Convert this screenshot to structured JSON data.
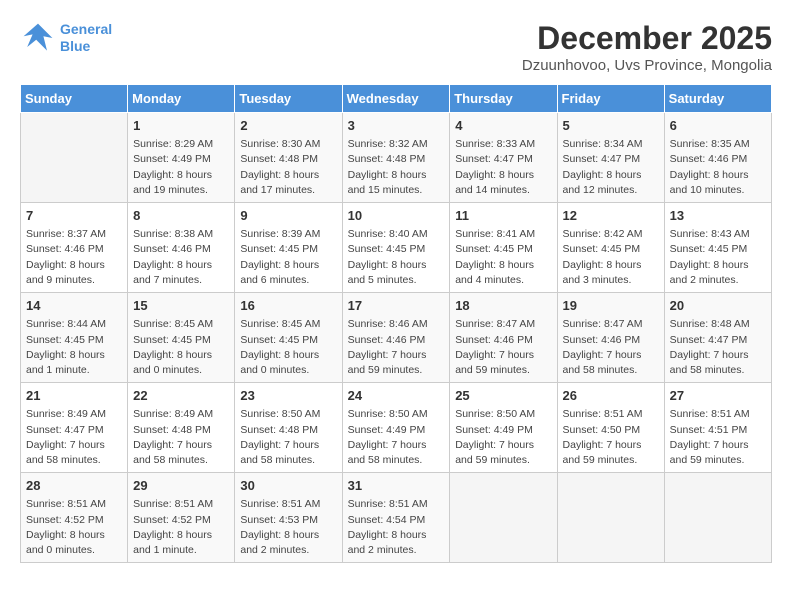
{
  "header": {
    "logo_line1": "General",
    "logo_line2": "Blue",
    "month": "December 2025",
    "location": "Dzuunhovoo, Uvs Province, Mongolia"
  },
  "weekdays": [
    "Sunday",
    "Monday",
    "Tuesday",
    "Wednesday",
    "Thursday",
    "Friday",
    "Saturday"
  ],
  "weeks": [
    [
      {
        "day": "",
        "content": ""
      },
      {
        "day": "1",
        "content": "Sunrise: 8:29 AM\nSunset: 4:49 PM\nDaylight: 8 hours\nand 19 minutes."
      },
      {
        "day": "2",
        "content": "Sunrise: 8:30 AM\nSunset: 4:48 PM\nDaylight: 8 hours\nand 17 minutes."
      },
      {
        "day": "3",
        "content": "Sunrise: 8:32 AM\nSunset: 4:48 PM\nDaylight: 8 hours\nand 15 minutes."
      },
      {
        "day": "4",
        "content": "Sunrise: 8:33 AM\nSunset: 4:47 PM\nDaylight: 8 hours\nand 14 minutes."
      },
      {
        "day": "5",
        "content": "Sunrise: 8:34 AM\nSunset: 4:47 PM\nDaylight: 8 hours\nand 12 minutes."
      },
      {
        "day": "6",
        "content": "Sunrise: 8:35 AM\nSunset: 4:46 PM\nDaylight: 8 hours\nand 10 minutes."
      }
    ],
    [
      {
        "day": "7",
        "content": "Sunrise: 8:37 AM\nSunset: 4:46 PM\nDaylight: 8 hours\nand 9 minutes."
      },
      {
        "day": "8",
        "content": "Sunrise: 8:38 AM\nSunset: 4:46 PM\nDaylight: 8 hours\nand 7 minutes."
      },
      {
        "day": "9",
        "content": "Sunrise: 8:39 AM\nSunset: 4:45 PM\nDaylight: 8 hours\nand 6 minutes."
      },
      {
        "day": "10",
        "content": "Sunrise: 8:40 AM\nSunset: 4:45 PM\nDaylight: 8 hours\nand 5 minutes."
      },
      {
        "day": "11",
        "content": "Sunrise: 8:41 AM\nSunset: 4:45 PM\nDaylight: 8 hours\nand 4 minutes."
      },
      {
        "day": "12",
        "content": "Sunrise: 8:42 AM\nSunset: 4:45 PM\nDaylight: 8 hours\nand 3 minutes."
      },
      {
        "day": "13",
        "content": "Sunrise: 8:43 AM\nSunset: 4:45 PM\nDaylight: 8 hours\nand 2 minutes."
      }
    ],
    [
      {
        "day": "14",
        "content": "Sunrise: 8:44 AM\nSunset: 4:45 PM\nDaylight: 8 hours\nand 1 minute."
      },
      {
        "day": "15",
        "content": "Sunrise: 8:45 AM\nSunset: 4:45 PM\nDaylight: 8 hours\nand 0 minutes."
      },
      {
        "day": "16",
        "content": "Sunrise: 8:45 AM\nSunset: 4:45 PM\nDaylight: 8 hours\nand 0 minutes."
      },
      {
        "day": "17",
        "content": "Sunrise: 8:46 AM\nSunset: 4:46 PM\nDaylight: 7 hours\nand 59 minutes."
      },
      {
        "day": "18",
        "content": "Sunrise: 8:47 AM\nSunset: 4:46 PM\nDaylight: 7 hours\nand 59 minutes."
      },
      {
        "day": "19",
        "content": "Sunrise: 8:47 AM\nSunset: 4:46 PM\nDaylight: 7 hours\nand 58 minutes."
      },
      {
        "day": "20",
        "content": "Sunrise: 8:48 AM\nSunset: 4:47 PM\nDaylight: 7 hours\nand 58 minutes."
      }
    ],
    [
      {
        "day": "21",
        "content": "Sunrise: 8:49 AM\nSunset: 4:47 PM\nDaylight: 7 hours\nand 58 minutes."
      },
      {
        "day": "22",
        "content": "Sunrise: 8:49 AM\nSunset: 4:48 PM\nDaylight: 7 hours\nand 58 minutes."
      },
      {
        "day": "23",
        "content": "Sunrise: 8:50 AM\nSunset: 4:48 PM\nDaylight: 7 hours\nand 58 minutes."
      },
      {
        "day": "24",
        "content": "Sunrise: 8:50 AM\nSunset: 4:49 PM\nDaylight: 7 hours\nand 58 minutes."
      },
      {
        "day": "25",
        "content": "Sunrise: 8:50 AM\nSunset: 4:49 PM\nDaylight: 7 hours\nand 59 minutes."
      },
      {
        "day": "26",
        "content": "Sunrise: 8:51 AM\nSunset: 4:50 PM\nDaylight: 7 hours\nand 59 minutes."
      },
      {
        "day": "27",
        "content": "Sunrise: 8:51 AM\nSunset: 4:51 PM\nDaylight: 7 hours\nand 59 minutes."
      }
    ],
    [
      {
        "day": "28",
        "content": "Sunrise: 8:51 AM\nSunset: 4:52 PM\nDaylight: 8 hours\nand 0 minutes."
      },
      {
        "day": "29",
        "content": "Sunrise: 8:51 AM\nSunset: 4:52 PM\nDaylight: 8 hours\nand 1 minute."
      },
      {
        "day": "30",
        "content": "Sunrise: 8:51 AM\nSunset: 4:53 PM\nDaylight: 8 hours\nand 2 minutes."
      },
      {
        "day": "31",
        "content": "Sunrise: 8:51 AM\nSunset: 4:54 PM\nDaylight: 8 hours\nand 2 minutes."
      },
      {
        "day": "",
        "content": ""
      },
      {
        "day": "",
        "content": ""
      },
      {
        "day": "",
        "content": ""
      }
    ]
  ]
}
